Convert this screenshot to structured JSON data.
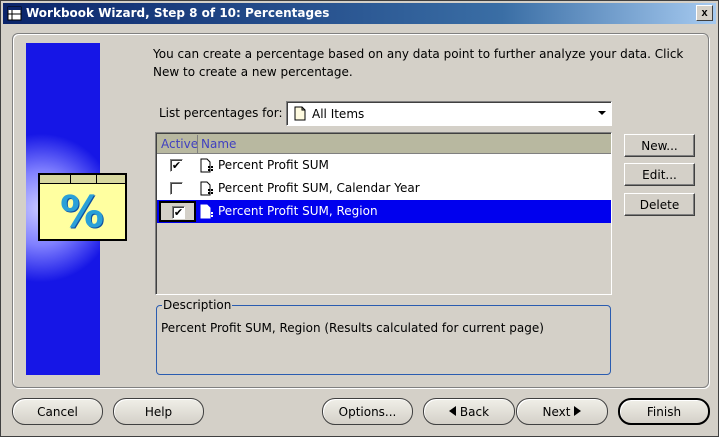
{
  "window": {
    "title": "Workbook Wizard, Step 8 of 10: Percentages",
    "close_glyph": "x"
  },
  "intro_text": "You can create a percentage based on any data point to further analyze your data. Click New to create a new percentage.",
  "list_for": {
    "label": "List percentages for:",
    "selected": "All Items",
    "icon": "document-icon"
  },
  "grid": {
    "columns": [
      "Active",
      "Name"
    ],
    "rows": [
      {
        "active": true,
        "check_glyph": "✔",
        "name": "Percent Profit SUM",
        "selected": false
      },
      {
        "active": false,
        "check_glyph": "",
        "name": "Percent Profit SUM, Calendar Year",
        "selected": false
      },
      {
        "active": true,
        "check_glyph": "✔",
        "name": "Percent Profit SUM, Region",
        "selected": true
      }
    ],
    "selection_color": "#0000ee"
  },
  "description": {
    "legend": "Description",
    "text": "Percent Profit SUM, Region (Results calculated for current page)"
  },
  "side_buttons": {
    "new": "New...",
    "edit": "Edit...",
    "delete": "Delete"
  },
  "footer": {
    "cancel": "Cancel",
    "help": "Help",
    "options": "Options...",
    "back": "Back",
    "next": "Next",
    "finish": "Finish"
  },
  "illustration": {
    "glyph": "%",
    "icon": "percent-card-icon"
  },
  "colors": {
    "titlebar": "#0a246a",
    "side_panel": "#1616e6",
    "face": "#d4d0c8"
  }
}
